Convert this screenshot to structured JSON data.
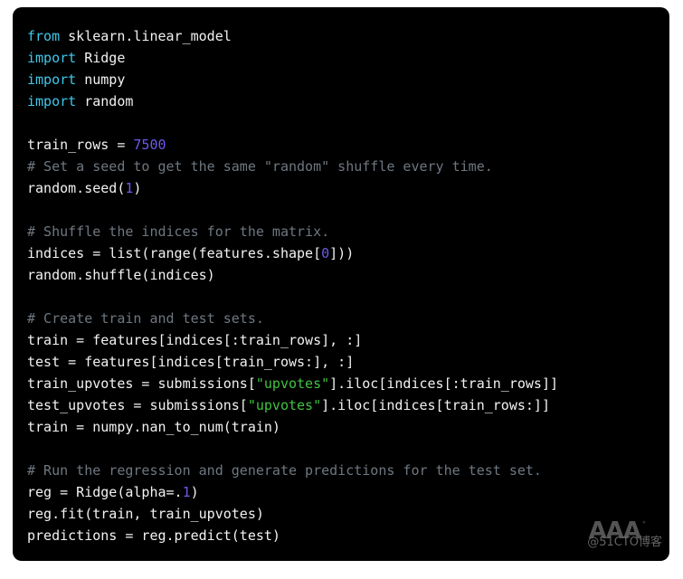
{
  "editor": {
    "language": "python",
    "background_color": "#000000",
    "page_background_color": "#ffffff",
    "theme_colors": {
      "keyword": "#3fc8ea",
      "string": "#41c341",
      "number": "#6d5aee",
      "comment": "#6e7780",
      "plain_text": "#f2f2f2"
    },
    "lines": [
      {
        "number": 1,
        "text": "from sklearn.linear_model",
        "tokens": [
          {
            "t": "from",
            "k": "kw"
          },
          {
            "t": " sklearn.linear_model",
            "k": "plain"
          }
        ]
      },
      {
        "number": 2,
        "text": "import Ridge",
        "tokens": [
          {
            "t": "import",
            "k": "kw"
          },
          {
            "t": " Ridge",
            "k": "plain"
          }
        ]
      },
      {
        "number": 3,
        "text": "import numpy",
        "tokens": [
          {
            "t": "import",
            "k": "kw"
          },
          {
            "t": " numpy",
            "k": "plain"
          }
        ]
      },
      {
        "number": 4,
        "text": "import random",
        "tokens": [
          {
            "t": "import",
            "k": "kw"
          },
          {
            "t": " random",
            "k": "plain"
          }
        ]
      },
      {
        "number": 5,
        "text": "",
        "tokens": []
      },
      {
        "number": 6,
        "text": "train_rows = 7500",
        "tokens": [
          {
            "t": "train_rows = ",
            "k": "plain"
          },
          {
            "t": "7500",
            "k": "num"
          }
        ]
      },
      {
        "number": 7,
        "text": "# Set a seed to get the same \"random\" shuffle every time.",
        "tokens": [
          {
            "t": "# Set a seed to get the same \"random\" shuffle every time.",
            "k": "com"
          }
        ]
      },
      {
        "number": 8,
        "text": "random.seed(1)",
        "tokens": [
          {
            "t": "random.seed(",
            "k": "plain"
          },
          {
            "t": "1",
            "k": "num"
          },
          {
            "t": ")",
            "k": "plain"
          }
        ]
      },
      {
        "number": 9,
        "text": "",
        "tokens": []
      },
      {
        "number": 10,
        "text": "# Shuffle the indices for the matrix.",
        "tokens": [
          {
            "t": "# Shuffle the indices for the matrix.",
            "k": "com"
          }
        ]
      },
      {
        "number": 11,
        "text": "indices = list(range(features.shape[0]))",
        "tokens": [
          {
            "t": "indices = list(range(features.shape[",
            "k": "plain"
          },
          {
            "t": "0",
            "k": "num"
          },
          {
            "t": "]))",
            "k": "plain"
          }
        ]
      },
      {
        "number": 12,
        "text": "random.shuffle(indices)",
        "tokens": [
          {
            "t": "random.shuffle(indices)",
            "k": "plain"
          }
        ]
      },
      {
        "number": 13,
        "text": "",
        "tokens": []
      },
      {
        "number": 14,
        "text": "# Create train and test sets.",
        "tokens": [
          {
            "t": "# Create train and test sets.",
            "k": "com"
          }
        ]
      },
      {
        "number": 15,
        "text": "train = features[indices[:train_rows], :]",
        "tokens": [
          {
            "t": "train = features[indices[:train_rows], :]",
            "k": "plain"
          }
        ]
      },
      {
        "number": 16,
        "text": "test = features[indices[train_rows:], :]",
        "tokens": [
          {
            "t": "test = features[indices[train_rows:], :]",
            "k": "plain"
          }
        ]
      },
      {
        "number": 17,
        "text": "train_upvotes = submissions[\"upvotes\"].iloc[indices[:train_rows]]",
        "tokens": [
          {
            "t": "train_upvotes = submissions[",
            "k": "plain"
          },
          {
            "t": "\"upvotes\"",
            "k": "str"
          },
          {
            "t": "].iloc[indices[:train_rows]]",
            "k": "plain"
          }
        ]
      },
      {
        "number": 18,
        "text": "test_upvotes = submissions[\"upvotes\"].iloc[indices[train_rows:]]",
        "tokens": [
          {
            "t": "test_upvotes = submissions[",
            "k": "plain"
          },
          {
            "t": "\"upvotes\"",
            "k": "str"
          },
          {
            "t": "].iloc[indices[train_rows:]]",
            "k": "plain"
          }
        ]
      },
      {
        "number": 19,
        "text": "train = numpy.nan_to_num(train)",
        "tokens": [
          {
            "t": "train = numpy.nan_to_num(train)",
            "k": "plain"
          }
        ]
      },
      {
        "number": 20,
        "text": "",
        "tokens": []
      },
      {
        "number": 21,
        "text": "# Run the regression and generate predictions for the test set.",
        "tokens": [
          {
            "t": "# Run the regression and generate predictions for the test set.",
            "k": "com"
          }
        ]
      },
      {
        "number": 22,
        "text": "reg = Ridge(alpha=.1)",
        "tokens": [
          {
            "t": "reg = Ridge(alpha=.",
            "k": "plain"
          },
          {
            "t": "1",
            "k": "num"
          },
          {
            "t": ")",
            "k": "plain"
          }
        ]
      },
      {
        "number": 23,
        "text": "reg.fit(train, train_upvotes)",
        "tokens": [
          {
            "t": "reg.fit(train, train_upvotes)",
            "k": "plain"
          }
        ]
      },
      {
        "number": 24,
        "text": "predictions = reg.predict(test)",
        "tokens": [
          {
            "t": "predictions = reg.predict(test)",
            "k": "plain"
          }
        ]
      }
    ]
  },
  "watermark": {
    "logo_text": "AAA",
    "degree_mark": "°",
    "site_text": "@51CTO博客"
  }
}
